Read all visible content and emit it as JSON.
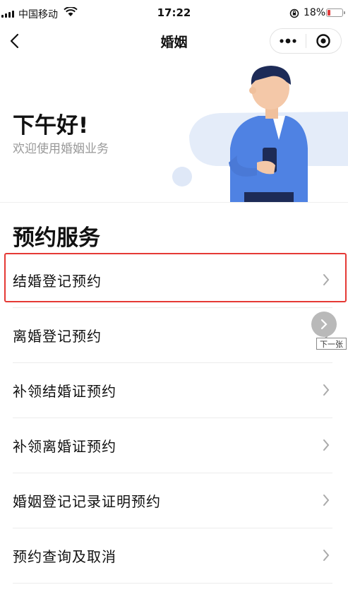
{
  "status_bar": {
    "carrier": "中国移动",
    "time": "17:22",
    "battery": "18%",
    "battery_level": 0.18,
    "icons": [
      "signal-icon",
      "wifi-icon",
      "orientation-lock-icon",
      "battery-icon"
    ]
  },
  "nav": {
    "title": "婚姻",
    "back_icon": "chevron-left-icon",
    "more_icon": "more-dots-icon",
    "close_icon": "target-circle-icon"
  },
  "banner": {
    "greeting": "下午好!",
    "subtitle": "欢迎使用婚姻业务",
    "illustration": "person-with-phone-illustration"
  },
  "section": {
    "title": "预约服务"
  },
  "services": [
    {
      "label": "结婚登记预约",
      "highlighted": true
    },
    {
      "label": "离婚登记预约"
    },
    {
      "label": "补领结婚证预约"
    },
    {
      "label": "补领离婚证预约"
    },
    {
      "label": "婚姻登记记录证明预约"
    },
    {
      "label": "预约查询及取消"
    }
  ],
  "floating": {
    "next_tooltip": "下一张",
    "next_icon": "chevron-right-icon"
  },
  "colors": {
    "highlight": "#e53935",
    "illustration_blue": "#4a7fe0",
    "illustration_bg": "#dfe8f7",
    "muted_text": "#999999"
  }
}
